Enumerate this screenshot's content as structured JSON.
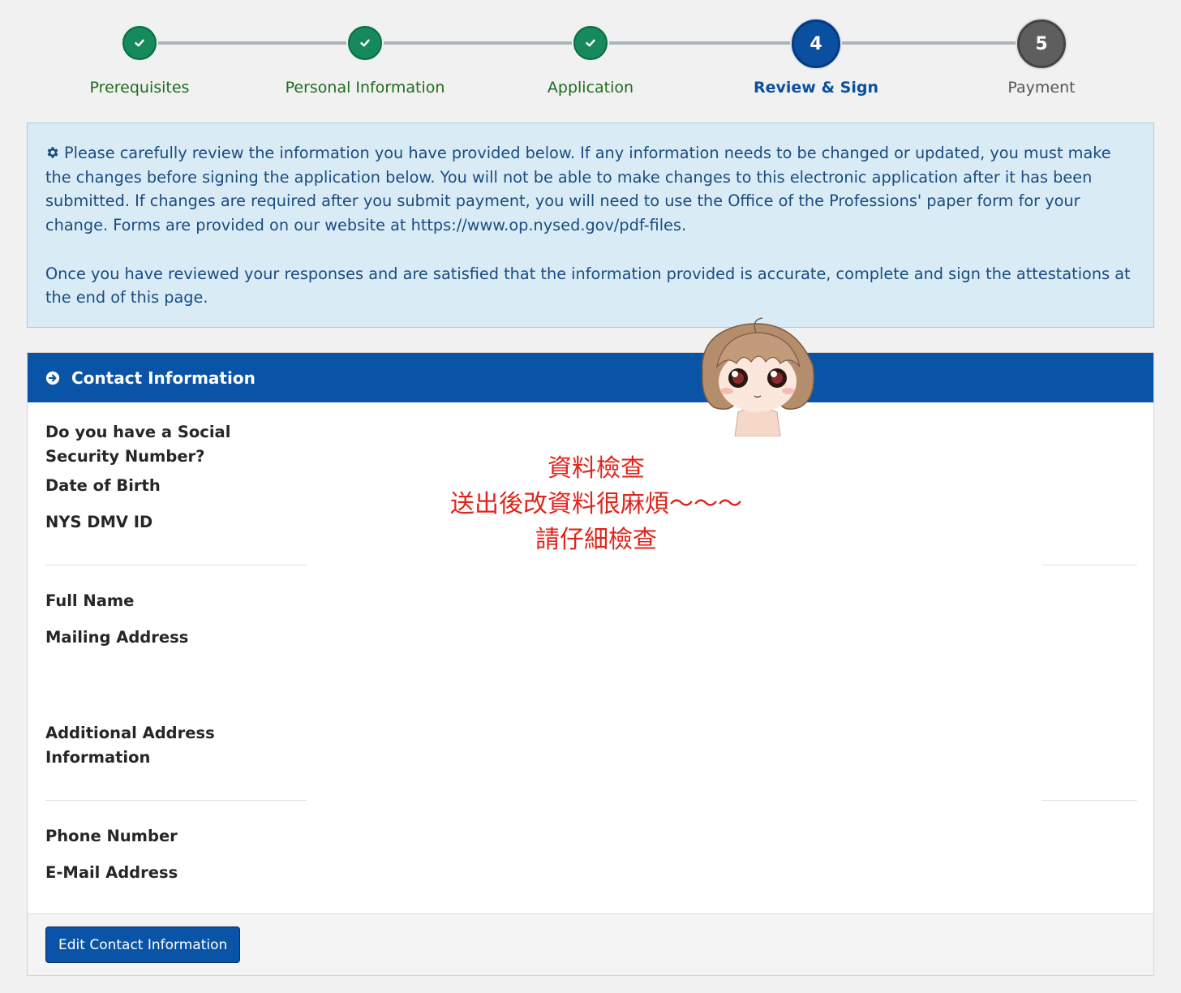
{
  "stepper": {
    "steps": [
      {
        "label": "Prerequisites",
        "state": "done"
      },
      {
        "label": "Personal Information",
        "state": "done"
      },
      {
        "label": "Application",
        "state": "done"
      },
      {
        "label": "Review & Sign",
        "state": "current",
        "number": "4"
      },
      {
        "label": "Payment",
        "state": "future",
        "number": "5"
      }
    ]
  },
  "alert": {
    "icon": "gear-icon",
    "paragraph1": "Please carefully review the information you have provided below. If any information needs to be changed or updated, you must make the changes before signing the application below. You will not be able to make changes to this electronic application after it has been submitted. If changes are required after you submit payment, you will need to use the Office of the Professions' paper form for your change. Forms are provided on our website at https://www.op.nysed.gov/pdf-files.",
    "paragraph2": "Once you have reviewed your responses and are satisfied that the information provided is accurate, complete and sign the attestations at the end of this page."
  },
  "panel": {
    "title": "Contact Information",
    "icon": "arrow-circle-right-icon",
    "fields": {
      "ssn": "Do you have a Social Security Number?",
      "dob": "Date of Birth",
      "dmv": "NYS DMV ID",
      "full_name": "Full Name",
      "mailing_address": "Mailing Address",
      "additional_address": "Additional Address Information",
      "phone": "Phone Number",
      "email": "E-Mail Address"
    },
    "edit_button": "Edit Contact Information"
  },
  "annotation": {
    "line1": "資料檢查",
    "line2": "送出後改資料很麻煩～～～",
    "line3": "請仔細檢查",
    "color": "#e0241b"
  },
  "colors": {
    "done": "#178a5c",
    "current": "#0a4fa0",
    "future": "#5e5e5e",
    "panel_header": "#0a54a8",
    "alert_bg": "#d9ecf6"
  }
}
